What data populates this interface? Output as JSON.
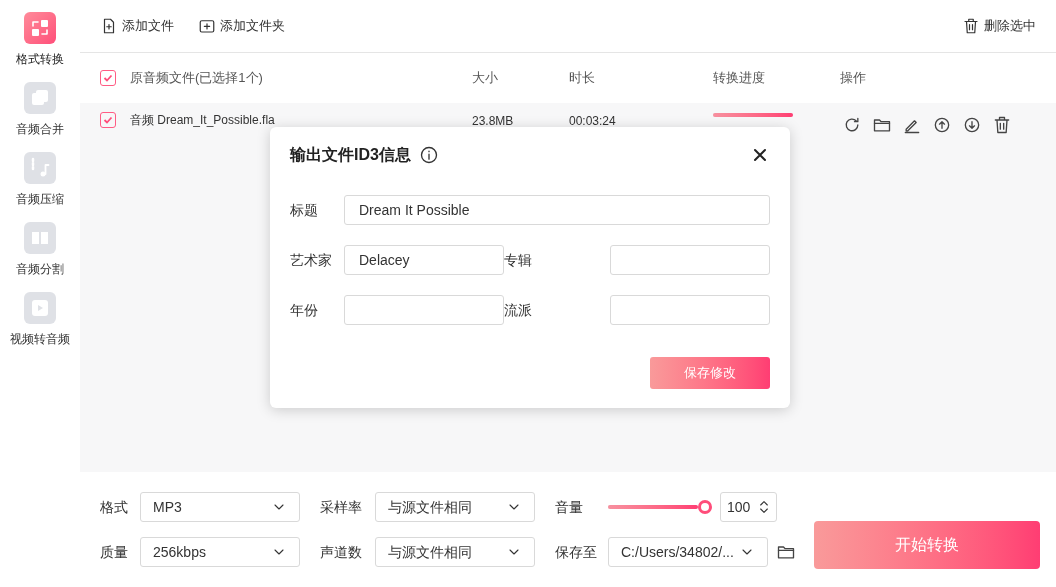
{
  "sidebar": {
    "items": [
      {
        "label": "格式转换",
        "selected": true,
        "kind": "convert"
      },
      {
        "label": "音频合并",
        "selected": false,
        "kind": "merge"
      },
      {
        "label": "音频压缩",
        "selected": false,
        "kind": "compress"
      },
      {
        "label": "音频分割",
        "selected": false,
        "kind": "split"
      },
      {
        "label": "视频转音频",
        "selected": false,
        "kind": "video"
      }
    ]
  },
  "toolbar": {
    "add_file": "添加文件",
    "add_folder": "添加文件夹",
    "delete_selected": "删除选中"
  },
  "table": {
    "header": {
      "checked": true,
      "columns": [
        "原音频文件(已选择1个)",
        "大小",
        "时长",
        "转换进度",
        "操作"
      ]
    },
    "rows": [
      {
        "checked": true,
        "name": "音频 Dream_It_Possible.fla",
        "size": "23.8MB",
        "duration": "00:03:24",
        "progress": {
          "level": 1
        }
      }
    ]
  },
  "dialog": {
    "title": "输出文件ID3信息",
    "fields": [
      {
        "label": "标题",
        "value": "Dream It Possible",
        "wide": true
      },
      {
        "label": "艺术家",
        "value": "Delacey",
        "wide": false
      },
      {
        "label": "专辑",
        "wide": false
      },
      {
        "label": "年份",
        "wide": false
      },
      {
        "label": "流派",
        "wide": false
      }
    ],
    "save": "保存修改"
  },
  "settings": {
    "format_label": "格式",
    "format": "MP3",
    "rate_label": "采样率",
    "rate": "与源文件相同",
    "volume_label": "音量",
    "volume": {
      "level": 1
    },
    "volume_value": "100",
    "quality_label": "质量",
    "quality": "256kbps",
    "channels_label": "声道数",
    "channels": "与源文件相同",
    "save_label": "保存至",
    "save_path": "C:/Users/34802/..."
  },
  "start": "开始转换"
}
